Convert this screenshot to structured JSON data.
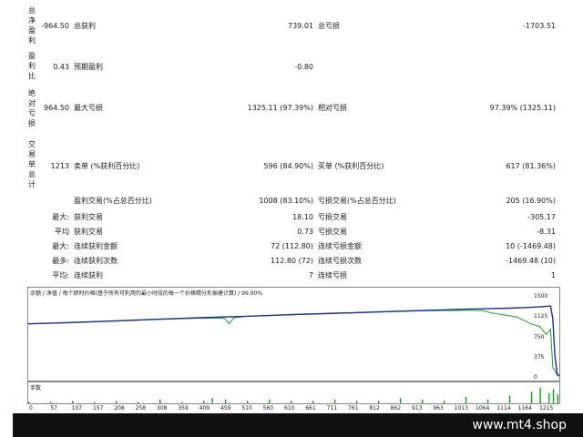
{
  "stats": {
    "net_profit": {
      "side_label": "总净盈利",
      "value": "-964.50",
      "gross_profit_label": "总获利",
      "gross_profit_value": "739.01",
      "gross_loss_label": "总亏损",
      "gross_loss_value": "-1703.51"
    },
    "profit_factor": {
      "side_label": "盈利比",
      "value": "0.43",
      "expected_payoff_label": "预期盈利",
      "expected_payoff_value": "-0.80"
    },
    "drawdown": {
      "side_label": "绝对亏损",
      "value": "964.50",
      "max_dd_label": "最大亏损",
      "max_dd_value": "1325.11 (97.39%)",
      "rel_dd_label": "相对亏损",
      "rel_dd_value": "97.39% (1325.11)"
    },
    "trades": {
      "side_label": "交易单总计",
      "value": "1213",
      "short_label": "卖单 (%获利百分比)",
      "short_value": "596 (84.90%)",
      "long_label": "买单 (%获利百分比)",
      "long_value": "617 (81.36%)"
    },
    "win_loss": {
      "win_label": "盈利交易(%占总百分比)",
      "win_value": "1008 (83.10%)",
      "loss_label": "亏损交易(%占总百分比)",
      "loss_value": "205 (16.90%)"
    },
    "largest": {
      "prefix": "最大:",
      "win_label": "获利交易",
      "win_value": "18.10",
      "loss_label": "亏损交易",
      "loss_value": "-305.17"
    },
    "average": {
      "prefix": "平均",
      "win_label": "获利交易",
      "win_value": "0.73",
      "loss_label": "亏损交易",
      "loss_value": "-8.31"
    },
    "max_consec": {
      "prefix": "最大:",
      "win_label": "连续获利金额",
      "win_value": "72 (112.80)",
      "loss_label": "连续亏损金额",
      "loss_value": "10 (-1469.48)"
    },
    "most_consec": {
      "prefix": "最多:",
      "win_label": "连续获利次数",
      "win_value": "112.80 (72)",
      "loss_label": "连续亏损次数",
      "loss_value": "-1469.48 (10)"
    },
    "avg_consec": {
      "prefix": "平均:",
      "win_label": "连续获利",
      "win_value": "7",
      "loss_label": "连续亏损",
      "loss_value": "1"
    }
  },
  "chart_data": {
    "type": "line",
    "legend_text": "余额 / 净值 / 每个即时价格(基于所有可利用的最小时段的每一个价格精分形振建计算) / 99.90%",
    "y_ticks": [
      "1500",
      "1125",
      "750",
      "375",
      "0"
    ],
    "ylim": [
      0,
      1500
    ],
    "x_ticks": [
      "0",
      "57",
      "107",
      "157",
      "208",
      "258",
      "308",
      "359",
      "409",
      "459",
      "510",
      "560",
      "610",
      "661",
      "711",
      "761",
      "812",
      "862",
      "913",
      "963",
      "1013",
      "1064",
      "1114",
      "1164",
      "1215"
    ],
    "xlim": [
      0,
      1215
    ],
    "series": [
      {
        "name": "余额",
        "color": "#1c2ea8",
        "x": [
          0,
          100,
          200,
          300,
          400,
          500,
          600,
          700,
          800,
          900,
          1000,
          1050,
          1100,
          1150,
          1180,
          1195,
          1200,
          1205,
          1210,
          1215
        ],
        "y": [
          1000,
          1025,
          1055,
          1085,
          1115,
          1140,
          1170,
          1195,
          1220,
          1245,
          1270,
          1280,
          1290,
          1305,
          1320,
          1330,
          1100,
          400,
          80,
          30
        ]
      },
      {
        "name": "净值",
        "color": "#1aa51a",
        "x": [
          0,
          100,
          200,
          300,
          400,
          450,
          460,
          470,
          500,
          600,
          700,
          800,
          900,
          1000,
          1040,
          1060,
          1100,
          1120,
          1150,
          1170,
          1185,
          1195,
          1200,
          1210,
          1215
        ],
        "y": [
          1000,
          1020,
          1050,
          1080,
          1105,
          1100,
          1000,
          1110,
          1140,
          1165,
          1190,
          1215,
          1240,
          1250,
          1245,
          1200,
          1150,
          1120,
          1000,
          950,
          800,
          900,
          200,
          50,
          30
        ]
      }
    ],
    "volume": {
      "label": "手数",
      "color": "#1aa51a",
      "x": [
        0,
        50,
        100,
        150,
        200,
        250,
        300,
        350,
        400,
        420,
        450,
        500,
        550,
        600,
        650,
        700,
        750,
        800,
        850,
        900,
        950,
        1000,
        1050,
        1100,
        1150,
        1170,
        1190,
        1200,
        1210
      ],
      "y": [
        1,
        1,
        2,
        1,
        2,
        1,
        3,
        1,
        2,
        4,
        3,
        2,
        3,
        2,
        2,
        3,
        2,
        2,
        4,
        3,
        2,
        5,
        3,
        6,
        9,
        12,
        8,
        11,
        7
      ]
    }
  },
  "footer": {
    "brand": "www.mt4.shop"
  }
}
